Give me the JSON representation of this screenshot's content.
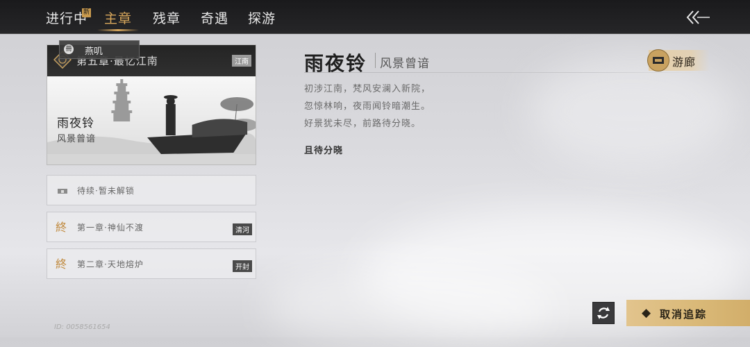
{
  "topbar": {
    "tabs": [
      {
        "label": "进行中"
      },
      {
        "label": "主章"
      },
      {
        "label": "残章"
      },
      {
        "label": "奇遇"
      },
      {
        "label": "探游"
      }
    ],
    "new_badge": "新",
    "active_tab": "主章",
    "back_icon": "double-chevron-left-icon"
  },
  "chapter_card": {
    "title": "第五章·最忆江南",
    "region": "江南",
    "speaker_icon_glyph": "冊",
    "speaker_name": "燕叽",
    "story_title": "雨夜铃",
    "story_subtitle": "风景曾谙"
  },
  "chapter_list": [
    {
      "label": "待续·暂未解锁",
      "tag": "",
      "icon": "locked-icon"
    },
    {
      "label": "第一章·神仙不渡",
      "tag": "清河",
      "icon": "chapter-seal-icon"
    },
    {
      "label": "第二章·天地熔炉",
      "tag": "开封",
      "icon": "chapter-seal-icon"
    }
  ],
  "row_glyph": "終",
  "uid": "ID: 0058561654",
  "detail": {
    "title": "雨夜铃",
    "subtitle": "风景曾谙",
    "poem": [
      "初涉江南，梵风安澜入新院，",
      "忽惊林响，夜雨闻铃暗潮生。",
      "好景犹未尽，前路待分晓。"
    ],
    "objective": "且待分晓"
  },
  "gallery_button": {
    "label": "游廊"
  },
  "cancel_button": {
    "label": "取消追踪",
    "icon": "◆"
  },
  "colors": {
    "accent": "#d9a85c",
    "topbar": "#1f1f21",
    "button_gold": "#dcbc7e"
  }
}
